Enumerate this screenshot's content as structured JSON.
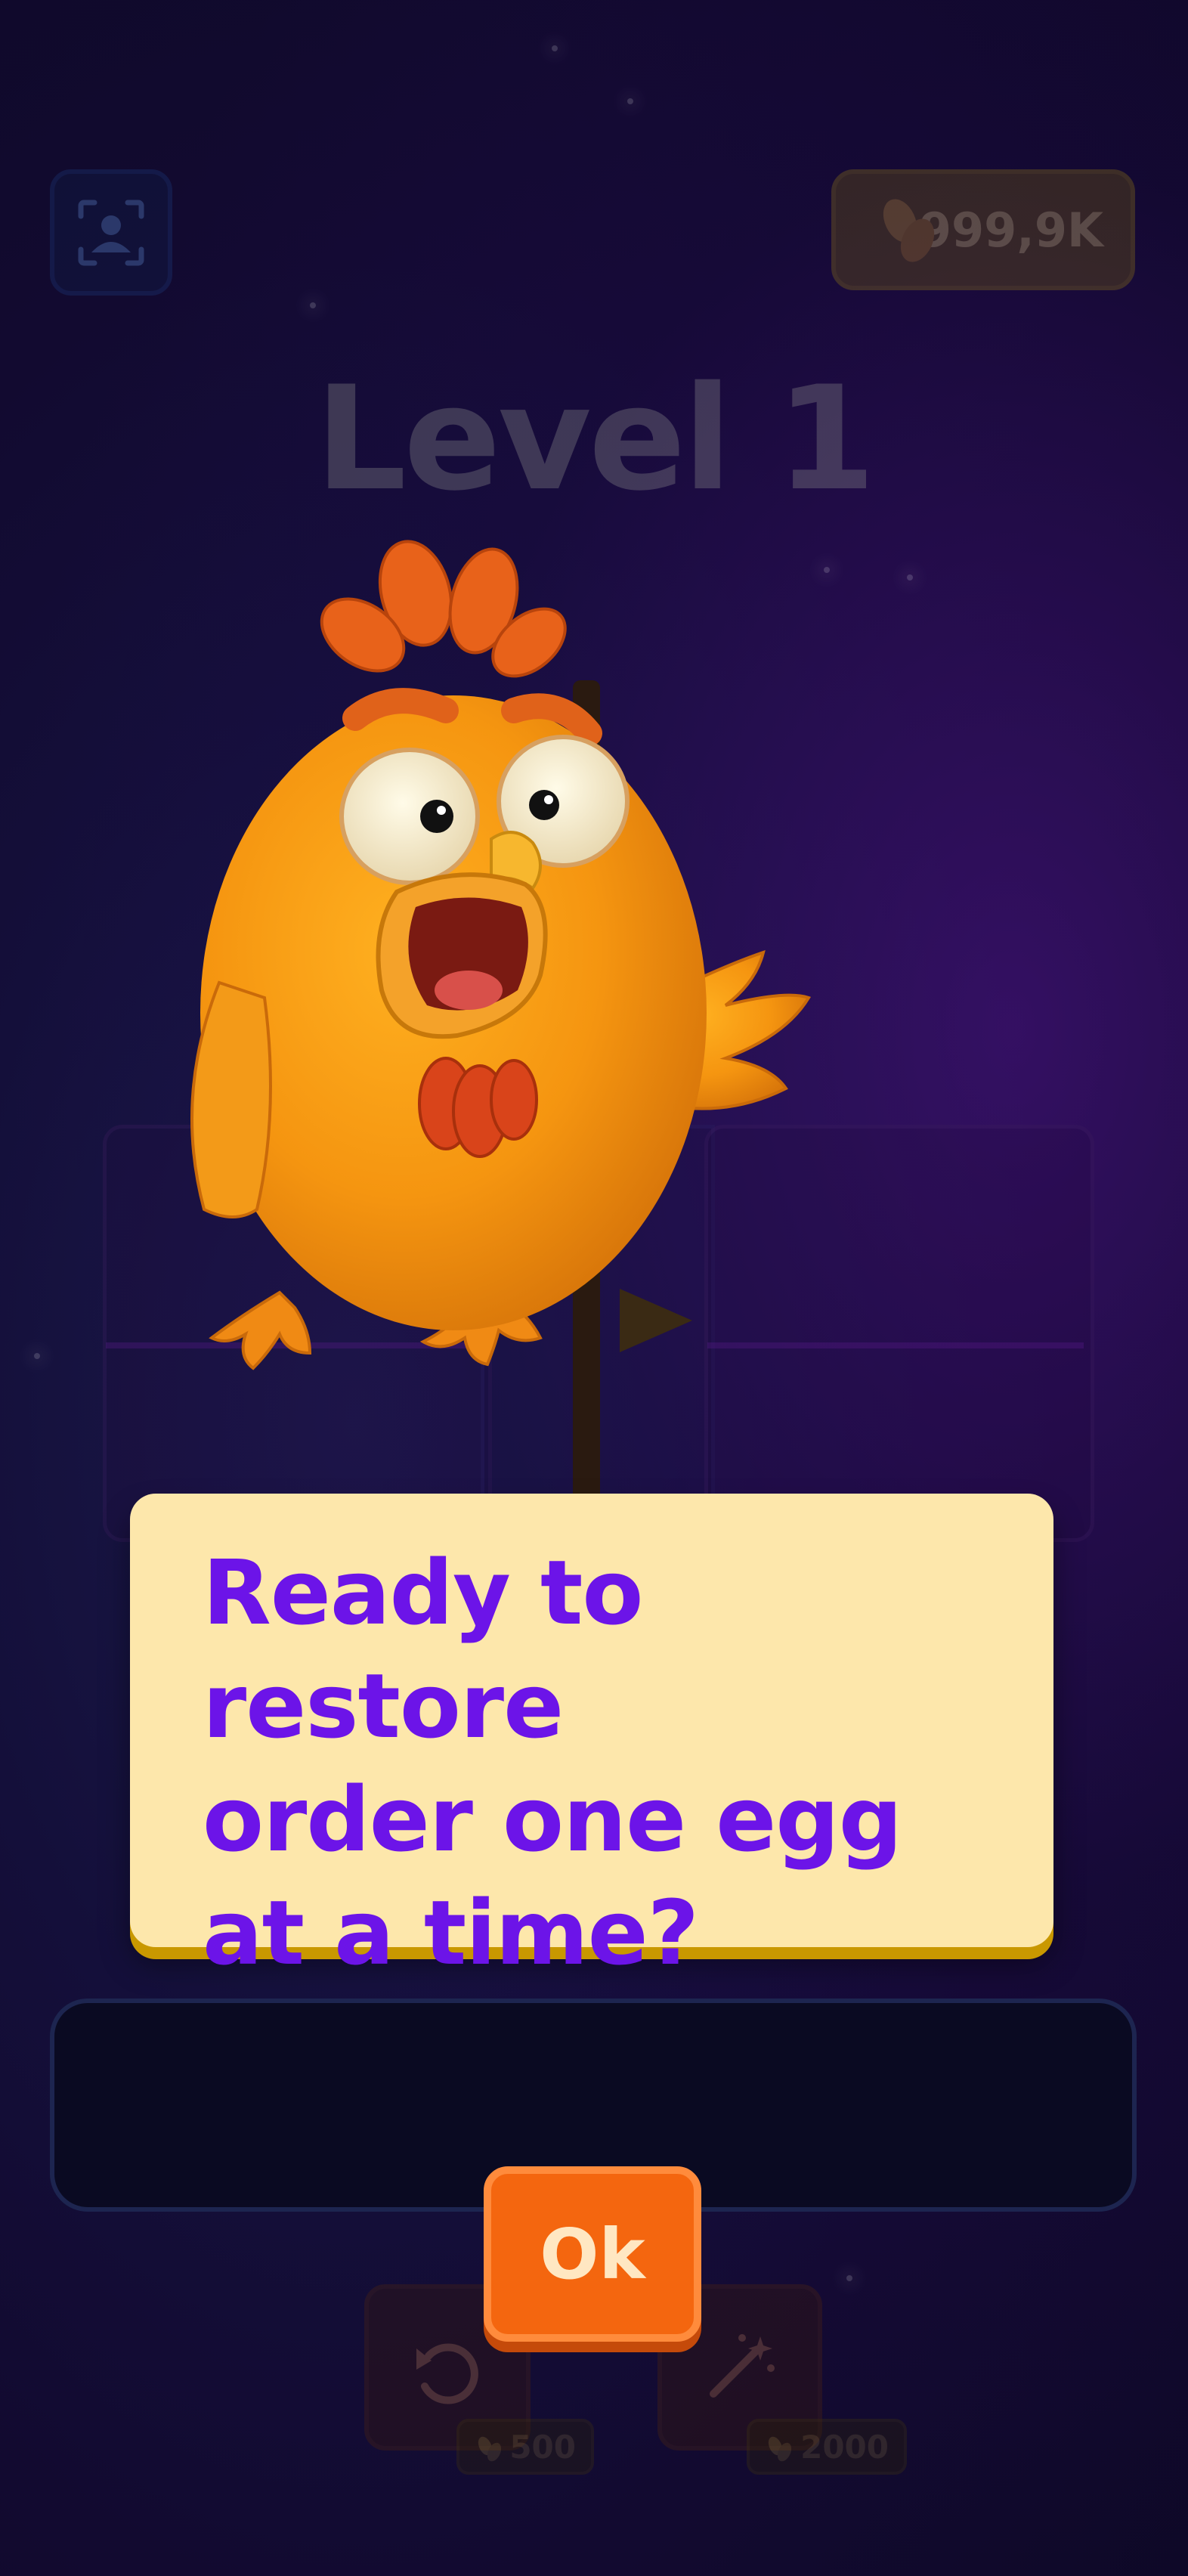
{
  "header": {
    "coins": "999,9K",
    "level_title": "Level 1"
  },
  "dialog": {
    "lines": [
      "Ready to restore",
      "order one egg",
      "at a time?"
    ]
  },
  "buttons": {
    "ok_label": "Ok"
  },
  "boosters": [
    {
      "icon": "undo-icon",
      "price": "500"
    },
    {
      "icon": "magic-wand-icon",
      "price": "2000"
    }
  ],
  "colors": {
    "dialog_text": "#6c14e8",
    "dialog_bg": "#fde7ab",
    "ok_button": "#f4660f"
  }
}
